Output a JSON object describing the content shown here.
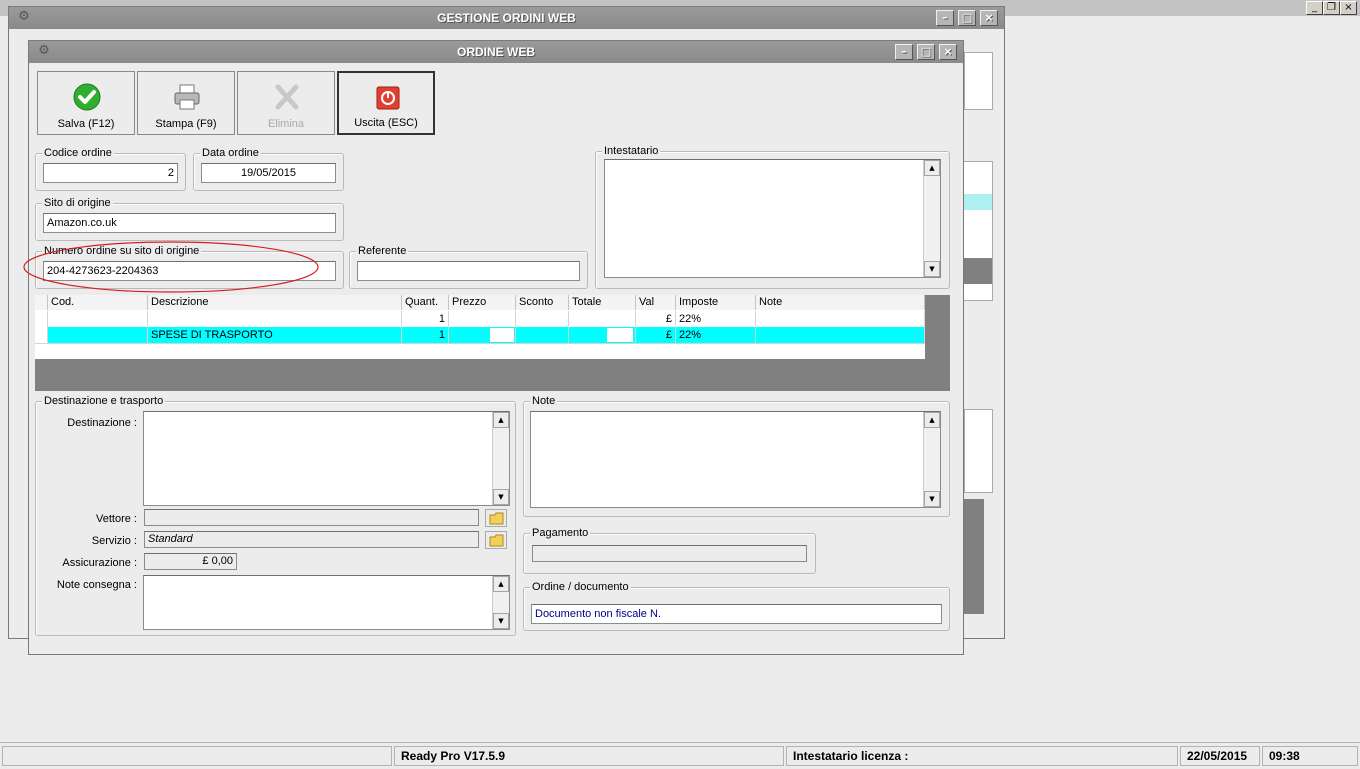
{
  "outer_window": {
    "title": "GESTIONE ORDINI WEB"
  },
  "inner_window": {
    "title": "ORDINE WEB"
  },
  "toolbar": {
    "save_label": "Salva (F12)",
    "print_label": "Stampa (F9)",
    "delete_label": "Elimina",
    "exit_label": "Uscita (ESC)"
  },
  "order": {
    "code_label": "Codice ordine",
    "code_value": "2",
    "date_label": "Data ordine",
    "date_value": "19/05/2015",
    "site_label": "Sito di origine",
    "site_value": "Amazon.co.uk",
    "number_label": "Numero ordine su sito di origine",
    "number_value": "204-4273623-2204363",
    "referent_label": "Referente",
    "referent_value": "",
    "holder_label": "Intestatario"
  },
  "grid": {
    "columns": [
      "Cod.",
      "Descrizione",
      "Quant.",
      "Prezzo",
      "Sconto",
      "Totale",
      "Val",
      "Imposte",
      "Note"
    ],
    "rows": [
      {
        "cod": "",
        "descrizione": "",
        "quant": "1",
        "prezzo": "",
        "sconto": "",
        "totale": "",
        "val": "£",
        "imposte": "22%",
        "note": ""
      },
      {
        "cod": "",
        "descrizione": "SPESE DI TRASPORTO",
        "quant": "1",
        "prezzo": "",
        "sconto": "",
        "totale": "",
        "val": "£",
        "imposte": "22%",
        "note": ""
      }
    ]
  },
  "shipping": {
    "group_label": "Destinazione e trasporto",
    "destination_label": "Destinazione :",
    "carrier_label": "Vettore :",
    "carrier_value": "",
    "service_label": "Servizio :",
    "service_value": "Standard",
    "insurance_label": "Assicurazione :",
    "insurance_value": "£ 0,00",
    "delivery_notes_label": "Note consegna :"
  },
  "notes": {
    "label": "Note"
  },
  "payment": {
    "label": "Pagamento",
    "value": ""
  },
  "document": {
    "label": "Ordine / documento",
    "value": "Documento non fiscale N."
  },
  "statusbar": {
    "version": "Ready Pro V17.5.9",
    "license_label": "Intestatario licenza :",
    "date": "22/05/2015",
    "time": "09:38"
  },
  "colors": {
    "selected_row": "#00ffff",
    "document_text": "#00008b",
    "annotation": "#d41e1e"
  },
  "icons": [
    "check-icon",
    "printer-icon",
    "delete-x-icon",
    "power-icon",
    "folder-icon",
    "gear-icon"
  ]
}
